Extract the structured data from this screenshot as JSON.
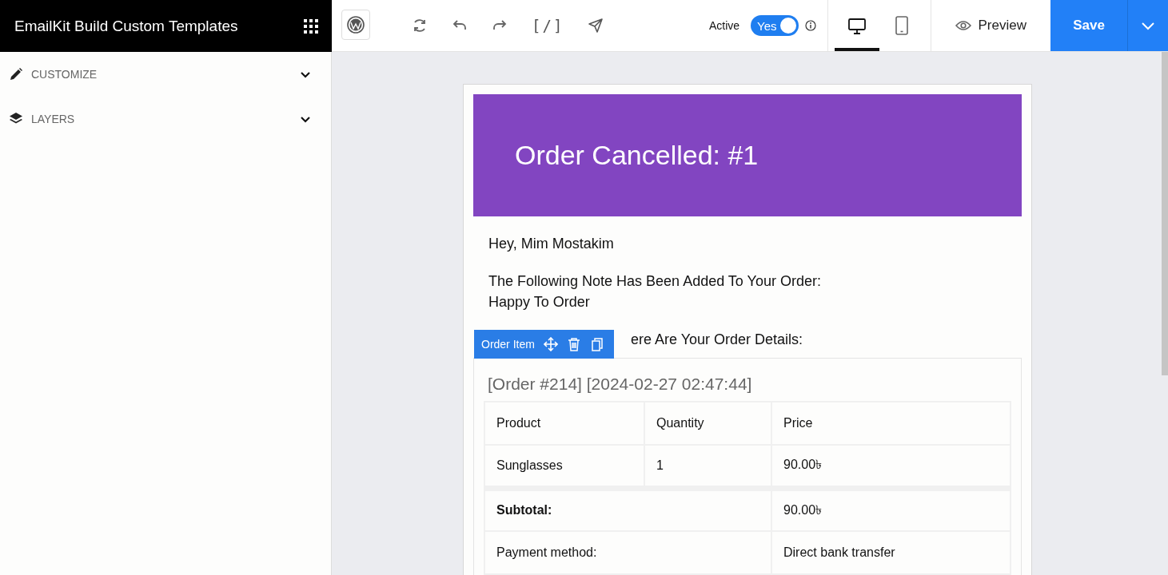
{
  "header": {
    "title": "EmailKit Build Custom Templates"
  },
  "sidebar": {
    "sections": [
      {
        "kind": "customize",
        "label": "CUSTOMIZE",
        "expanded": false
      },
      {
        "kind": "layers",
        "label": "LAYERS",
        "expanded": false
      }
    ]
  },
  "toolbar": {
    "shortcode": "[/]",
    "active_label": "Active",
    "toggle": {
      "label": "Yes",
      "on": true
    },
    "devices": [
      {
        "kind": "desktop",
        "selected": true
      },
      {
        "kind": "mobile",
        "selected": false
      }
    ],
    "preview": "Preview",
    "save": "Save"
  },
  "email": {
    "heading": "Order Cancelled: #1",
    "greeting": "Hey, Mim Mostakim",
    "note_lines": [
      "The Following Note Has Been Added To Your Order:",
      "Happy To Order"
    ],
    "reminder": "ere Are Your Order Details:",
    "element_toolbar": {
      "label": "Order Item"
    },
    "order_title": "[Order #214] [2024-02-27 02:47:44]",
    "table": {
      "columns": [
        "Product",
        "Quantity",
        "Price"
      ],
      "rows": [
        [
          "Sunglasses",
          "1",
          "90.00৳"
        ]
      ],
      "totals": [
        {
          "label": "Subtotal:",
          "value": "90.00৳"
        },
        {
          "label": "Payment method:",
          "value": "Direct bank transfer"
        }
      ]
    }
  }
}
